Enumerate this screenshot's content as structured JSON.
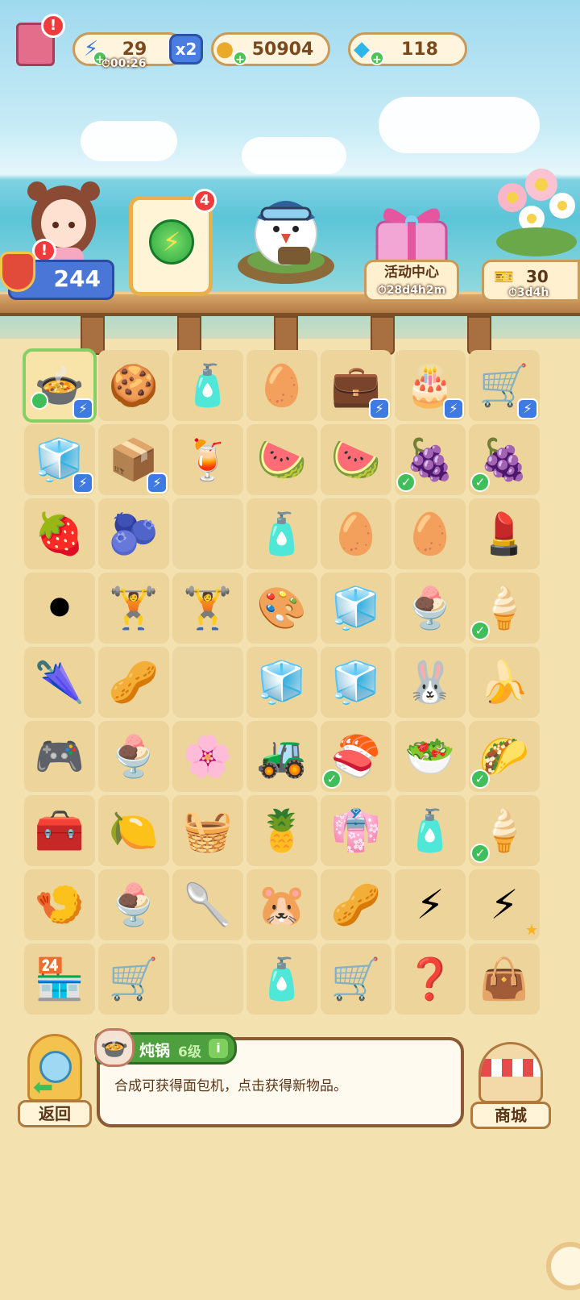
{
  "top_bar": {
    "energy": {
      "value": "29",
      "timer": "00:26",
      "multiplier": "x2"
    },
    "coins": {
      "value": "50904"
    },
    "gems": {
      "value": "118"
    }
  },
  "left_panel": {
    "notification_mark": "!",
    "level_value": "244"
  },
  "energy_box": {
    "badge_count": "4"
  },
  "event_center": {
    "label": "活动中心",
    "timer": "28d4h2m"
  },
  "flower_event": {
    "count": "30",
    "timer": "3d4h"
  },
  "board": {
    "rows": [
      [
        {
          "icon": "stew-pot-icon",
          "glyph": "🍲",
          "selected": true,
          "dot": true,
          "bolt": true
        },
        {
          "icon": "cookie-plate-icon",
          "glyph": "🍪"
        },
        {
          "icon": "spray-bottle-icon",
          "glyph": "🧴"
        },
        {
          "icon": "sponge-icon",
          "glyph": "🥚"
        },
        {
          "icon": "black-case-icon",
          "glyph": "💼",
          "bolt": true
        },
        {
          "icon": "cake-stand-icon",
          "glyph": "🎂",
          "bolt": true
        },
        {
          "icon": "cart-stall-icon",
          "glyph": "🛒",
          "bolt": true
        }
      ],
      [
        {
          "icon": "cooler-box-icon",
          "glyph": "🧊",
          "bolt": true
        },
        {
          "icon": "blue-cooler-icon",
          "glyph": "📦",
          "bolt": true
        },
        {
          "icon": "dragonfruit-drink-icon",
          "glyph": "🍹"
        },
        {
          "icon": "watermelon-drink-icon",
          "glyph": "🍉"
        },
        {
          "icon": "watermelon-drink-icon",
          "glyph": "🍉"
        },
        {
          "icon": "grape-dessert-icon",
          "glyph": "🍇",
          "check": true
        },
        {
          "icon": "grape-dessert-icon",
          "glyph": "🍇",
          "check": true
        }
      ],
      [
        {
          "icon": "strawberry-icon",
          "glyph": "🍓"
        },
        {
          "icon": "blueberry-icon",
          "glyph": "🫐"
        },
        {
          "icon": "empty-cell",
          "glyph": ""
        },
        {
          "icon": "spray-bottle-icon",
          "glyph": "🧴"
        },
        {
          "icon": "sponge-icon",
          "glyph": "🥚"
        },
        {
          "icon": "sponge-icon",
          "glyph": "🥚"
        },
        {
          "icon": "lipstick-icon",
          "glyph": "💄"
        }
      ],
      [
        {
          "icon": "weight-plate-icon",
          "glyph": "⚫"
        },
        {
          "icon": "dumbbell-small-icon",
          "glyph": "🏋"
        },
        {
          "icon": "dumbbell-icon",
          "glyph": "🏋"
        },
        {
          "icon": "makeup-palette-icon",
          "glyph": "🎨"
        },
        {
          "icon": "ice-cubes-icon",
          "glyph": "🧊"
        },
        {
          "icon": "ice-cream-cup-icon",
          "glyph": "🍨"
        },
        {
          "icon": "ice-cream-cone-icon",
          "glyph": "🍦",
          "check": true
        }
      ],
      [
        {
          "icon": "umbrella-icon",
          "glyph": "🌂"
        },
        {
          "icon": "seed-icon",
          "glyph": "🥜"
        },
        {
          "icon": "empty-cell",
          "glyph": ""
        },
        {
          "icon": "ice-cubes-icon",
          "glyph": "🧊"
        },
        {
          "icon": "ice-cubes-icon",
          "glyph": "🧊"
        },
        {
          "icon": "bunny-slippers-icon",
          "glyph": "🐰"
        },
        {
          "icon": "banana-icon",
          "glyph": "🍌"
        }
      ],
      [
        {
          "icon": "game-console-icon",
          "glyph": "🎮"
        },
        {
          "icon": "ice-cream-cup-icon",
          "glyph": "🍨"
        },
        {
          "icon": "cosmetics-set-icon",
          "glyph": "🌸"
        },
        {
          "icon": "lawn-mower-icon",
          "glyph": "🚜"
        },
        {
          "icon": "sushi-plate-icon",
          "glyph": "🍣",
          "check": true
        },
        {
          "icon": "salmon-salad-icon",
          "glyph": "🥗"
        },
        {
          "icon": "taco-plate-icon",
          "glyph": "🌮",
          "check": true
        }
      ],
      [
        {
          "icon": "tool-chest-icon",
          "glyph": "🧰"
        },
        {
          "icon": "lemon-dessert-icon",
          "glyph": "🍋"
        },
        {
          "icon": "shopping-basket-icon",
          "glyph": "🧺"
        },
        {
          "icon": "pineapple-icon",
          "glyph": "🍍"
        },
        {
          "icon": "towel-icon",
          "glyph": "👘"
        },
        {
          "icon": "spray-bottle-icon",
          "glyph": "🧴"
        },
        {
          "icon": "ice-cream-cone-icon",
          "glyph": "🍦",
          "check": true
        }
      ],
      [
        {
          "icon": "fried-shrimp-icon",
          "glyph": "🍤"
        },
        {
          "icon": "ice-cream-cup-icon",
          "glyph": "🍨"
        },
        {
          "icon": "spoon-icon",
          "glyph": "🥄"
        },
        {
          "icon": "hamster-icon",
          "glyph": "🐹"
        },
        {
          "icon": "seeds-pair-icon",
          "glyph": "🥜"
        },
        {
          "icon": "energy-orb-icon",
          "glyph": "⚡"
        },
        {
          "icon": "rainbow-energy-orb-icon",
          "glyph": "⚡",
          "star": true
        }
      ],
      [
        {
          "icon": "warehouse-icon",
          "glyph": "🏪"
        },
        {
          "icon": "hand-truck-icon",
          "glyph": "🛒"
        },
        {
          "icon": "empty-cell",
          "glyph": ""
        },
        {
          "icon": "sunscreen-icon",
          "glyph": "🧴"
        },
        {
          "icon": "luggage-cart-icon",
          "glyph": "🛒"
        },
        {
          "icon": "mystery-box-icon",
          "glyph": "❓"
        },
        {
          "icon": "cobweb-bag-icon",
          "glyph": "👜"
        }
      ]
    ]
  },
  "selected_item": {
    "name": "炖锅",
    "level": "6级",
    "info_mark": "i",
    "description": "合成可获得面包机，点击获得新物品。"
  },
  "buttons": {
    "back_label": "返回",
    "shop_label": "商城"
  },
  "colors": {
    "accent_green": "#4e9f3d",
    "bolt_blue": "#3f7ae3",
    "wood": "#b37a45"
  }
}
